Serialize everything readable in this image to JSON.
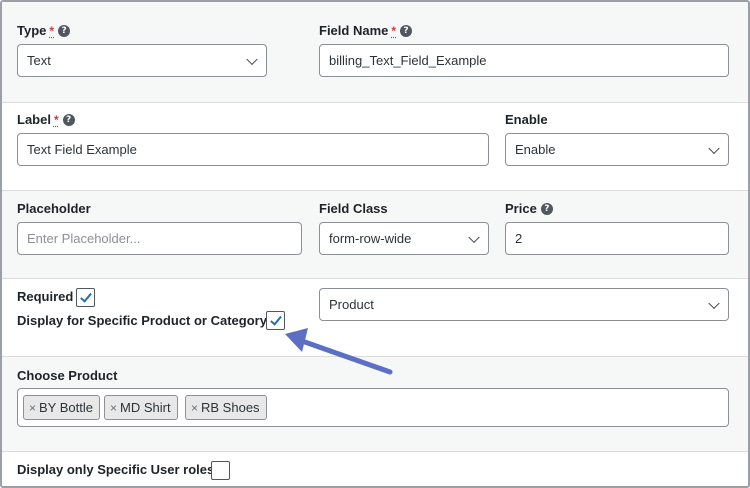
{
  "type_field": {
    "label": "Type",
    "required_mark": "*",
    "value": "Text"
  },
  "field_name": {
    "label": "Field Name",
    "required_mark": "*",
    "value": "billing_Text_Field_Example"
  },
  "label_field": {
    "label": "Label",
    "required_mark": "*",
    "value": "Text Field Example"
  },
  "enable_field": {
    "label": "Enable",
    "value": "Enable"
  },
  "placeholder_field": {
    "label": "Placeholder",
    "placeholder": "Enter Placeholder..."
  },
  "field_class": {
    "label": "Field Class",
    "value": "form-row-wide"
  },
  "price_field": {
    "label": "Price",
    "value": "2"
  },
  "required_toggle": {
    "label": "Required",
    "checked": true
  },
  "specific_product_toggle": {
    "label": "Display for Specific Product or Category",
    "checked": true
  },
  "product_select": {
    "value": "Product"
  },
  "choose_product": {
    "label": "Choose Product",
    "remove_glyph": "×",
    "tags": [
      "BY Bottle",
      "MD Shirt",
      "RB Shoes"
    ]
  },
  "user_roles_toggle": {
    "label": "Display only Specific User roles",
    "checked": false
  },
  "help_glyph": "?",
  "colors": {
    "accent": "#2271b1",
    "arrow": "#5b6fc4",
    "required": "#d63638"
  }
}
